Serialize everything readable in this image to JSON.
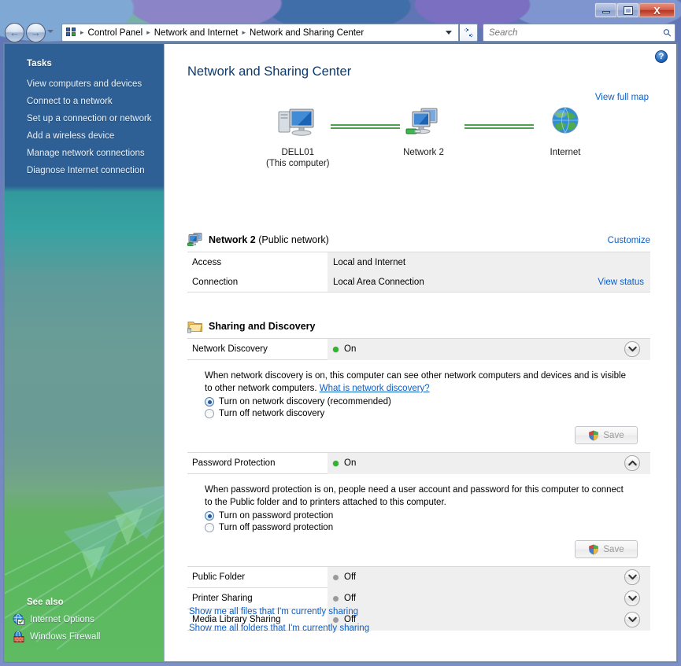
{
  "window": {
    "controls": {
      "minimize_label": "Minimize",
      "maximize_label": "Maximize",
      "close_label": "X"
    }
  },
  "navigation": {
    "back_label": "◀",
    "forward_label": "▶",
    "breadcrumb": [
      "Control Panel",
      "Network and Internet",
      "Network and Sharing Center"
    ],
    "separator": "▸",
    "refresh_label": "↻",
    "address_dropdown_label": "Recent pages"
  },
  "search": {
    "placeholder": "Search",
    "value": "",
    "icon": "search-icon"
  },
  "sidebar": {
    "tasks_header": "Tasks",
    "tasks": [
      "View computers and devices",
      "Connect to a network",
      "Set up a connection or network",
      "Add a wireless device",
      "Manage network connections",
      "Diagnose Internet connection"
    ],
    "see_also_header": "See also",
    "see_also": [
      {
        "label": "Internet Options",
        "icon": "internet-options-icon"
      },
      {
        "label": "Windows Firewall",
        "icon": "windows-firewall-icon"
      }
    ]
  },
  "content": {
    "page_title": "Network and Sharing Center",
    "help_label": "?",
    "view_full_map": "View full map",
    "map": {
      "nodes": [
        {
          "name": "DELL01",
          "sub": "(This computer)",
          "icon": "computer-icon"
        },
        {
          "name": "Network 2",
          "sub": "",
          "icon": "network-icon"
        },
        {
          "name": "Internet",
          "sub": "",
          "icon": "globe-icon"
        }
      ],
      "link_color": "#4ea14e"
    },
    "network": {
      "icon": "network-icon",
      "name": "Network 2",
      "type": " (Public network)",
      "customize_label": "Customize",
      "rows": [
        {
          "key": "Access",
          "value": "Local and Internet",
          "action": ""
        },
        {
          "key": "Connection",
          "value": "Local Area Connection",
          "action": "View status"
        }
      ]
    },
    "sharing": {
      "header": "Sharing and Discovery",
      "icon": "folder-share-icon",
      "items": [
        {
          "name": "Network Discovery",
          "state": "On",
          "state_kind": "on",
          "expanded": true,
          "chevron": "down",
          "description": "When network discovery is on, this computer can see other network computers and devices and is visible to other network computers. ",
          "help_link": "What is network discovery?",
          "options": [
            {
              "label": "Turn on network discovery (recommended)",
              "selected": true
            },
            {
              "label": "Turn off network discovery",
              "selected": false
            }
          ],
          "save_label": "Save",
          "save_enabled": false
        },
        {
          "name": "Password Protection",
          "state": "On",
          "state_kind": "on",
          "expanded": true,
          "chevron": "up",
          "description": "When password protection is on, people need a user account and password for this computer to connect to the Public folder and to printers attached to this computer.",
          "help_link": "",
          "options": [
            {
              "label": "Turn on password protection",
              "selected": true
            },
            {
              "label": "Turn off password protection",
              "selected": false
            }
          ],
          "save_label": "Save",
          "save_enabled": false
        },
        {
          "name": "Public Folder",
          "state": "Off",
          "state_kind": "off",
          "expanded": false,
          "chevron": "down"
        },
        {
          "name": "Printer Sharing",
          "state": "Off",
          "state_kind": "off",
          "expanded": false,
          "chevron": "down"
        },
        {
          "name": "Media Library Sharing",
          "state": "Off",
          "state_kind": "off",
          "expanded": false,
          "chevron": "down"
        }
      ]
    },
    "bottom_links": [
      "Show me all files that I'm currently sharing",
      "Show me all folders that I'm currently sharing"
    ]
  },
  "colors": {
    "link": "#0b5ec9",
    "title": "#0c3a6e",
    "status_on": "#31b531",
    "status_off": "#9a9a9a",
    "row_bg": "#efefef",
    "sidebar_top": "#2e6095",
    "sidebar_bottom": "#5cb85f"
  }
}
